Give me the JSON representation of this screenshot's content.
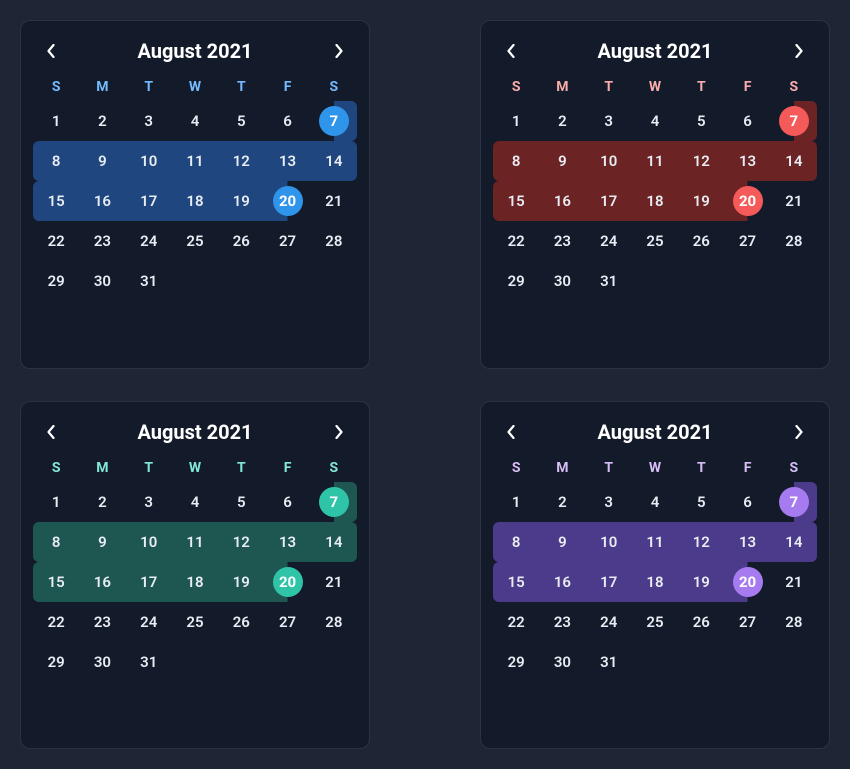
{
  "weekdays": [
    "S",
    "M",
    "T",
    "W",
    "T",
    "F",
    "S"
  ],
  "daysInMonth": 31,
  "startOffset": 0,
  "range": {
    "start": 7,
    "end": 20
  },
  "calendars": [
    {
      "id": "blue",
      "title": "August 2021",
      "weekdayColor": "#74baff",
      "rangeBg": "#1f467e",
      "endpointBg": "#2f95eb"
    },
    {
      "id": "red",
      "title": "August 2021",
      "weekdayColor": "#f8acac",
      "rangeBg": "#6b2323",
      "endpointBg": "#f45a5a"
    },
    {
      "id": "teal",
      "title": "August 2021",
      "weekdayColor": "#82e7d6",
      "rangeBg": "#1e5751",
      "endpointBg": "#2fc4a8"
    },
    {
      "id": "purple",
      "title": "August 2021",
      "weekdayColor": "#d6bdf5",
      "rangeBg": "#4c3b8a",
      "endpointBg": "#a67bf0"
    }
  ]
}
